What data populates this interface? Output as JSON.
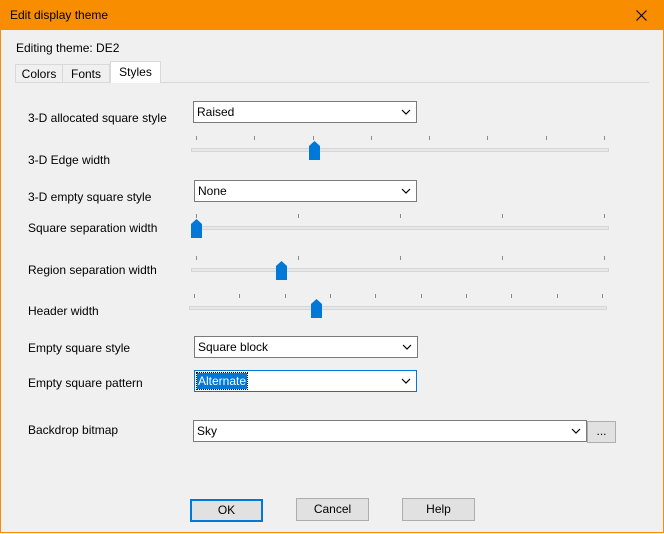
{
  "window": {
    "title": "Edit display theme",
    "accent": "#f98d00"
  },
  "header": {
    "editing_label": "Editing theme: DE2"
  },
  "tabs": [
    {
      "label": "Colors",
      "active": false
    },
    {
      "label": "Fonts",
      "active": false
    },
    {
      "label": "Styles",
      "active": true
    }
  ],
  "form": {
    "allocated_style": {
      "label": "3-D allocated square style",
      "value": "Raised"
    },
    "edge_width": {
      "label": "3-D Edge width",
      "level": 0.29
    },
    "empty_style": {
      "label": "3-D empty square style",
      "value": "None"
    },
    "square_sep": {
      "label": "Square separation width",
      "level": 0.0
    },
    "region_sep": {
      "label": "Region separation  width",
      "level": 0.21
    },
    "header_width": {
      "label": "Header width",
      "level": 0.3
    },
    "empty_square_style": {
      "label": "Empty square style",
      "value": "Square block"
    },
    "empty_square_pattern": {
      "label": "Empty square pattern",
      "value": "Alternate"
    },
    "backdrop": {
      "label": "Backdrop bitmap",
      "value": "Sky",
      "browse_label": "..."
    }
  },
  "buttons": {
    "ok": "OK",
    "cancel": "Cancel",
    "help": "Help"
  },
  "icons": {
    "close": "close-icon",
    "dropdown": "chevron-down-icon",
    "slider_thumb": "slider-thumb"
  }
}
